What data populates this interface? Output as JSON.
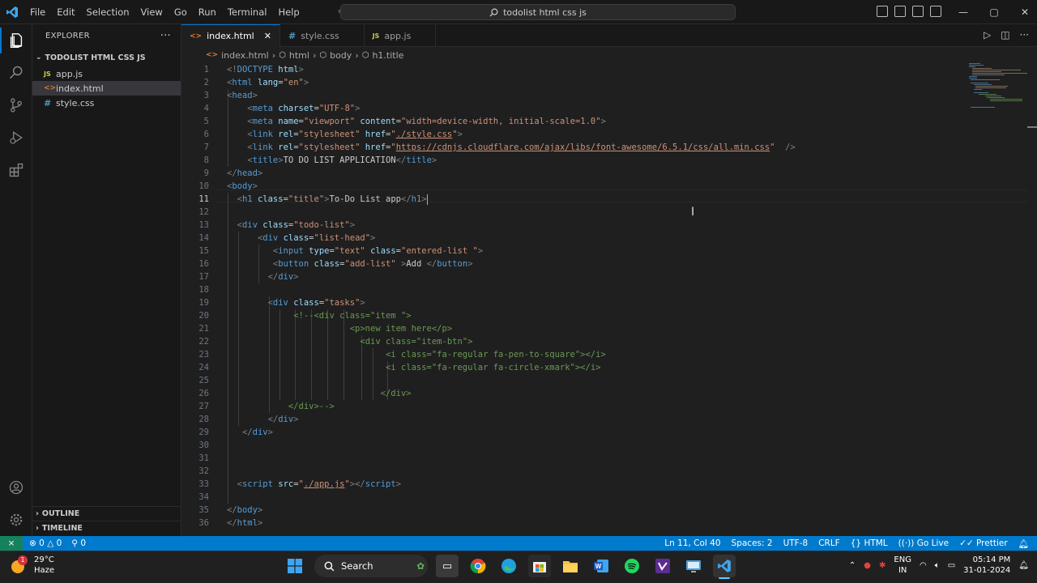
{
  "titlebar": {
    "menu": [
      "File",
      "Edit",
      "Selection",
      "View",
      "Go",
      "Run",
      "Terminal",
      "Help"
    ],
    "search_text": "todolist html css js"
  },
  "sidebar": {
    "header": "EXPLORER",
    "folder": "TODOLIST HTML CSS JS",
    "files": [
      {
        "badge": "JS",
        "name": "app.js"
      },
      {
        "badge": "<>",
        "name": "index.html"
      },
      {
        "badge": "#",
        "name": "style.css"
      }
    ],
    "outline": "OUTLINE",
    "timeline": "TIMELINE"
  },
  "tabs": [
    {
      "badge": "<>",
      "name": "index.html"
    },
    {
      "badge": "#",
      "name": "style.css"
    },
    {
      "badge": "JS",
      "name": "app.js"
    }
  ],
  "breadcrumb": [
    "index.html",
    "html",
    "body",
    "h1.title"
  ],
  "editor": {
    "current_line": 11,
    "line_numbers": [
      "1",
      "2",
      "3",
      "4",
      "5",
      "6",
      "7",
      "8",
      "9",
      "10",
      "11",
      "12",
      "13",
      "14",
      "15",
      "16",
      "17",
      "18",
      "19",
      "20",
      "21",
      "22",
      "23",
      "24",
      "25",
      "26",
      "27",
      "28",
      "29",
      "30",
      "31",
      "32",
      "33",
      "34",
      "35",
      "36"
    ]
  },
  "statusbar": {
    "errors": "0",
    "warnings": "0",
    "ports": "0",
    "position": "Ln 11, Col 40",
    "spaces": "Spaces: 2",
    "encoding": "UTF-8",
    "eol": "CRLF",
    "language": "HTML",
    "golive": "Go Live",
    "prettier": "Prettier"
  },
  "taskbar": {
    "weather_temp": "29°C",
    "weather_desc": "Haze",
    "weather_badge": "1",
    "search": "Search",
    "lang1": "ENG",
    "lang2": "IN",
    "time": "05:14 PM",
    "date": "31-01-2024"
  },
  "colors": {
    "accent": "#007acc",
    "remote": "#16825d",
    "tag": "#569cd6",
    "attr": "#9cdcfe",
    "string": "#ce9178",
    "comment": "#6a9955"
  }
}
